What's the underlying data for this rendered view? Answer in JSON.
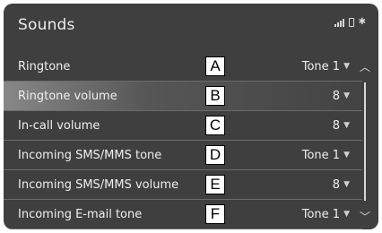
{
  "header": {
    "title": "Sounds"
  },
  "status_icons": [
    "signal-icon",
    "phone-icon",
    "bluetooth-icon"
  ],
  "rows": [
    {
      "label": "Ringtone",
      "value": "Tone 1",
      "callout": "A"
    },
    {
      "label": "Ringtone volume",
      "value": "8",
      "callout": "B"
    },
    {
      "label": "In-call volume",
      "value": "8",
      "callout": "C"
    },
    {
      "label": "Incoming SMS/MMS tone",
      "value": "Tone 1",
      "callout": "D"
    },
    {
      "label": "Incoming SMS/MMS volume",
      "value": "8",
      "callout": "E"
    },
    {
      "label": "Incoming E-mail tone",
      "value": "Tone 1",
      "callout": "F"
    }
  ],
  "selected_row": "Ringtone volume",
  "colors": {
    "screen_bg": "#3f3f3f",
    "text": "#efefef",
    "divider": "#6b6b6b"
  }
}
